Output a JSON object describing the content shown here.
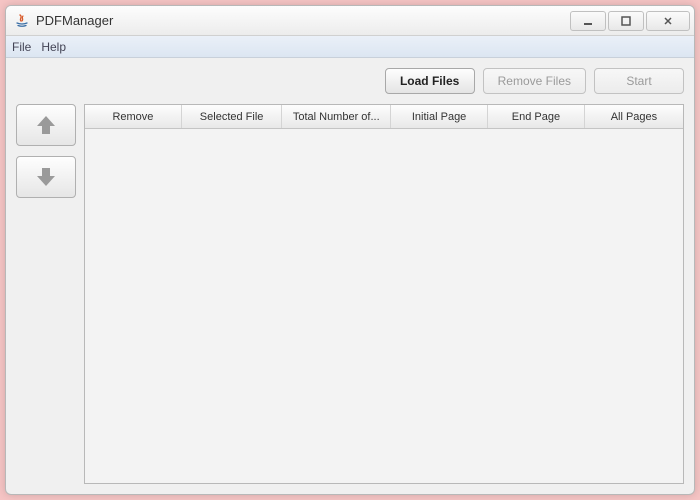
{
  "window": {
    "title": "PDFManager"
  },
  "menubar": {
    "file": "File",
    "help": "Help"
  },
  "toolbar": {
    "load_files": "Load Files",
    "remove_files": "Remove Files",
    "start": "Start"
  },
  "table": {
    "columns": {
      "remove": "Remove",
      "selected_file": "Selected File",
      "total_pages": "Total Number of...",
      "initial_page": "Initial Page",
      "end_page": "End Page",
      "all_pages": "All Pages"
    },
    "rows": []
  }
}
